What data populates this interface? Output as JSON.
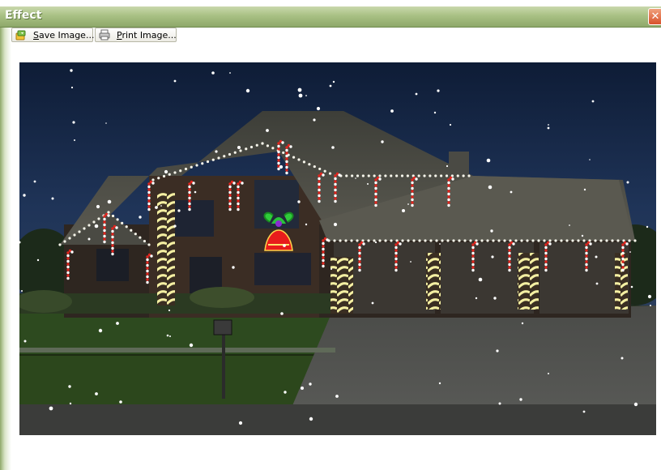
{
  "window": {
    "title": "Effect",
    "close_glyph": "✕"
  },
  "toolbar": {
    "save_label": "Save Image...",
    "print_label": "Print Image...",
    "save_icon": "save-icon",
    "print_icon": "printer-icon"
  },
  "image": {
    "subject": "house with christmas lights at night",
    "decorations": [
      "candy-cane-icon",
      "bell-icon",
      "snowflake-icon"
    ]
  }
}
